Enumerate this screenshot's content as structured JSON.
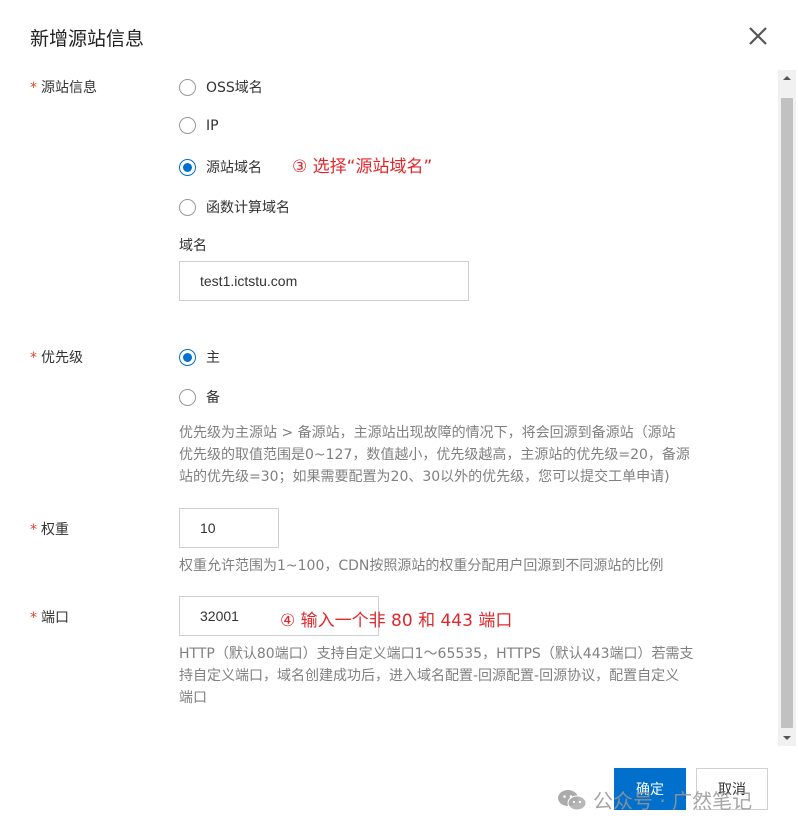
{
  "dialog": {
    "title": "新增源站信息",
    "close_icon": "close-icon"
  },
  "origin": {
    "label": "源站信息",
    "options": [
      {
        "label": "OSS域名",
        "checked": false
      },
      {
        "label": "IP",
        "checked": false
      },
      {
        "label": "源站域名",
        "checked": true
      },
      {
        "label": "函数计算域名",
        "checked": false
      }
    ],
    "annotation": "③ 选择“源站域名”",
    "domain_label": "域名",
    "domain_value": "test1.ictstu.com"
  },
  "priority": {
    "label": "优先级",
    "options": [
      {
        "label": "主",
        "checked": true
      },
      {
        "label": "备",
        "checked": false
      }
    ],
    "help_lines": [
      "优先级为主源站 > 备源站，主源站出现故障的情况下，将会回源到备源站（源站",
      "优先级的取值范围是0~127，数值越小，优先级越高，主源站的优先级=20，备源",
      "站的优先级=30；如果需要配置为20、30以外的优先级，您可以提交工单申请)"
    ]
  },
  "weight": {
    "label": "权重",
    "value": "10",
    "help": "权重允许范围为1~100，CDN按照源站的权重分配用户回源到不同源站的比例"
  },
  "port": {
    "label": "端口",
    "value": "32001",
    "annotation": "④ 输入一个非 80 和 443 端口",
    "help_lines": [
      "HTTP（默认80端口）支持自定义端口1～65535，HTTPS（默认443端口）若需支",
      "持自定义端口，域名创建成功后，进入域名配置-回源配置-回源协议，配置自定义",
      "端口"
    ]
  },
  "footer": {
    "ok_label": "确定",
    "cancel_label": "取消"
  },
  "watermark": {
    "icon": "wechat-icon",
    "text": "公众号 · 广然笔记"
  },
  "colors": {
    "primary": "#0070cc",
    "annotation": "#e0282c",
    "required": "#e0412c"
  }
}
